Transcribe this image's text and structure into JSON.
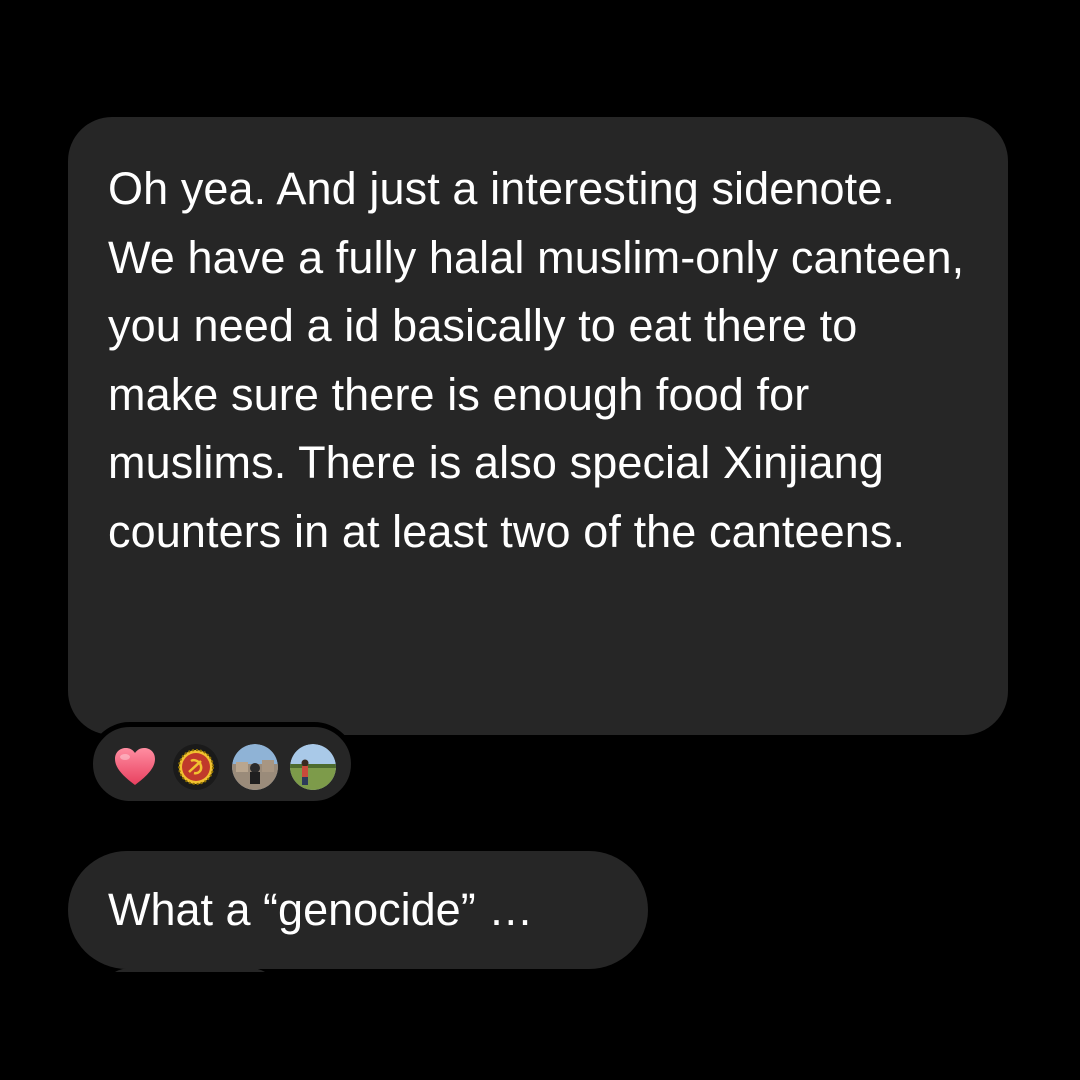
{
  "messages": [
    {
      "text": "Oh yea. And just a interesting sidenote. We have a fully halal muslim-only canteen, you need a id basically to eat there to make sure there is enough food for muslims. There is also special Xinjiang counters in at least two of the canteens."
    },
    {
      "text": "What a “genocide” …"
    }
  ],
  "reactions": [
    {
      "type": "heart",
      "icon": "heart-icon",
      "color": "#f25c78"
    },
    {
      "type": "avatar",
      "icon": "avatar-emblem-icon",
      "color": "#d4a017"
    },
    {
      "type": "avatar",
      "icon": "avatar-photo-icon",
      "color": "#7a8fa6"
    },
    {
      "type": "avatar",
      "icon": "avatar-field-icon",
      "color": "#7d9b4a"
    }
  ],
  "colors": {
    "background": "#000000",
    "bubble": "#262626",
    "text": "#ffffff"
  }
}
